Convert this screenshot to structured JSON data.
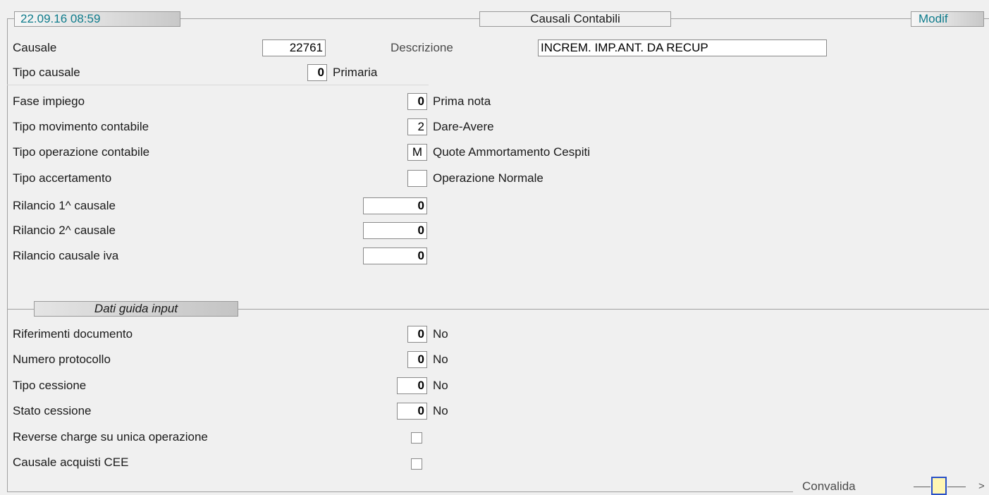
{
  "header": {
    "timestamp": "22.09.16 08:59",
    "title": "Causali Contabili",
    "mode": "Modif"
  },
  "main": {
    "causale": {
      "label": "Causale",
      "value": "22761"
    },
    "descrizione": {
      "label": "Descrizione",
      "value": "INCREM. IMP.ANT. DA RECUP"
    },
    "tipo_causale": {
      "label": "Tipo causale",
      "value": "0",
      "desc": "Primaria"
    },
    "fase_impiego": {
      "label": "Fase impiego",
      "value": "0",
      "desc": "Prima nota"
    },
    "tipo_movimento": {
      "label": "Tipo movimento contabile",
      "value": "2",
      "desc": "Dare-Avere"
    },
    "tipo_operazione": {
      "label": "Tipo operazione contabile",
      "value": "M",
      "desc": "Quote Ammortamento Cespiti"
    },
    "tipo_accertamento": {
      "label": "Tipo accertamento",
      "value": "",
      "desc": "Operazione Normale"
    },
    "rilancio1": {
      "label": "Rilancio 1^ causale",
      "value": "0"
    },
    "rilancio2": {
      "label": "Rilancio 2^ causale",
      "value": "0"
    },
    "rilancio_iva": {
      "label": "Rilancio causale iva",
      "value": "0"
    }
  },
  "dati_guida": {
    "title": "Dati guida input",
    "riferimenti": {
      "label": "Riferimenti documento",
      "value": "0",
      "desc": "No"
    },
    "protocollo": {
      "label": "Numero protocollo",
      "value": "0",
      "desc": "No"
    },
    "tipo_cessione": {
      "label": "Tipo cessione",
      "value": "0",
      "desc": "No"
    },
    "stato_cessione": {
      "label": "Stato cessione",
      "value": "0",
      "desc": "No"
    },
    "reverse_charge": {
      "label": "Reverse charge su unica operazione",
      "checked": false
    },
    "acquisti_cee": {
      "label": "Causale acquisti CEE",
      "checked": false
    }
  },
  "footer": {
    "convalida_label": "Convalida",
    "more": ">"
  },
  "colors": {
    "teal_text": "#0f7c8c",
    "background": "#f0f0f0",
    "button_fill": "#fff6b3",
    "button_border": "#2850c8"
  }
}
